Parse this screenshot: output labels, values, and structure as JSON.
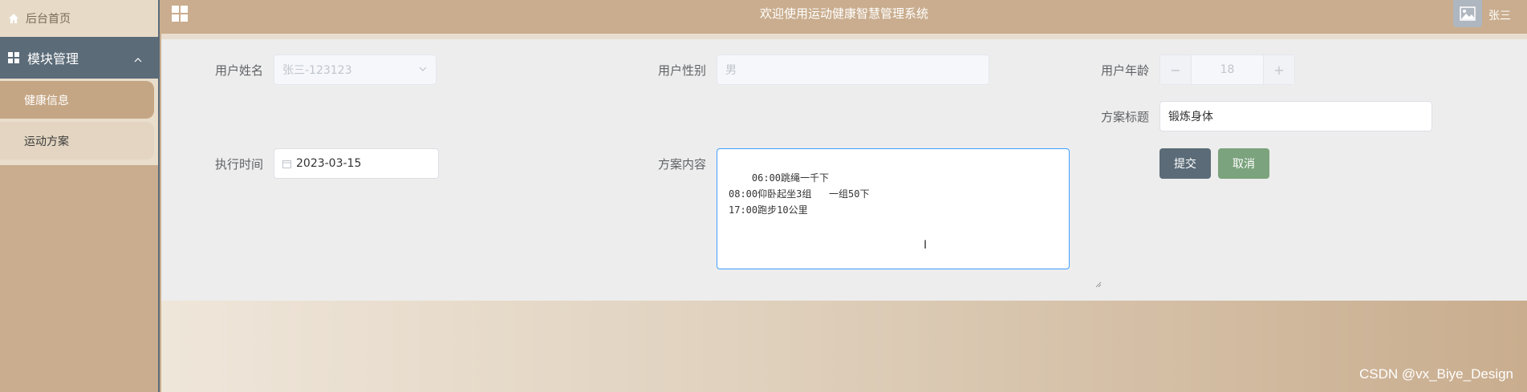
{
  "sidebar": {
    "home_label": "后台首页",
    "module_label": "模块管理",
    "items": [
      {
        "label": "健康信息",
        "active": true
      },
      {
        "label": "运动方案",
        "active": false
      }
    ]
  },
  "header": {
    "title": "欢迎使用运动健康智慧管理系统",
    "username": "张三"
  },
  "form": {
    "username_label": "用户姓名",
    "username_value": "张三-123123",
    "gender_label": "用户性别",
    "gender_value": "男",
    "age_label": "用户年龄",
    "age_value": "18",
    "age_minus": "−",
    "age_plus": "+",
    "plan_title_label": "方案标题",
    "plan_title_value": "锻炼身体",
    "exec_time_label": "执行时间",
    "exec_time_value": "2023-03-15",
    "plan_content_label": "方案内容",
    "plan_content_value": "06:00跳绳一千下\n08:00仰卧起坐3组   一组50下\n17:00跑步10公里",
    "submit_label": "提交",
    "cancel_label": "取消"
  },
  "watermark": "CSDN @vx_Biye_Design",
  "colors": {
    "sidebar_bg": "#c9ad8e",
    "module_bg": "#5b6b78",
    "submit_bg": "#5b6b78",
    "cancel_bg": "#7ba37d",
    "focus_border": "#409eff"
  }
}
